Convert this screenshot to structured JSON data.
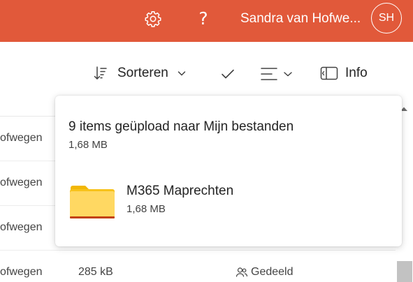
{
  "header": {
    "settings_icon": "gear-icon",
    "help_label": "?",
    "user_name": "Sandra van Hofwe...",
    "avatar_initials": "SH",
    "bar_color": "#e1593a"
  },
  "command_bar": {
    "sort_label": "Sorteren",
    "info_label": "Info"
  },
  "file_rows": [
    {
      "name": "ofwegen",
      "size": "",
      "sharing": ""
    },
    {
      "name": "ofwegen",
      "size": "",
      "sharing": ""
    },
    {
      "name": "ofwegen",
      "size": "",
      "sharing": ""
    },
    {
      "name": "ofwegen",
      "size": "285 kB",
      "sharing": "Gedeeld"
    }
  ],
  "upload_popup": {
    "title": "9 items geüpload naar Mijn bestanden",
    "total_size": "1,68 MB",
    "item": {
      "name": "M365 Maprechten",
      "size": "1,68 MB",
      "icon": "folder-icon"
    }
  }
}
